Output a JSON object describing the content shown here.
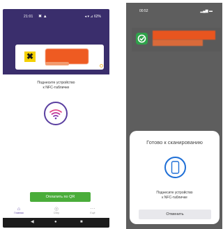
{
  "left_screen": {
    "status_time": "21:01",
    "status_battery": "62%",
    "brand_logo": "✖",
    "instruction": [
      "Поднесите устройство",
      "к NFC-табличке"
    ],
    "pay_button_label": "Оплатить по QR",
    "tabs": [
      {
        "label": "Главная",
        "icon": "home-icon"
      },
      {
        "label": "Сбер",
        "icon": "target-icon"
      },
      {
        "label": "Ещё",
        "icon": "more-icon"
      }
    ],
    "nav": {
      "back": "◀",
      "home": "●",
      "recents": "■"
    }
  },
  "right_screen": {
    "status_time": "00:52",
    "sheet_title": "Готово к сканированию",
    "instruction": [
      "Поднесите устройство",
      "к NFC-табличке"
    ],
    "cancel_label": "Отменить"
  }
}
